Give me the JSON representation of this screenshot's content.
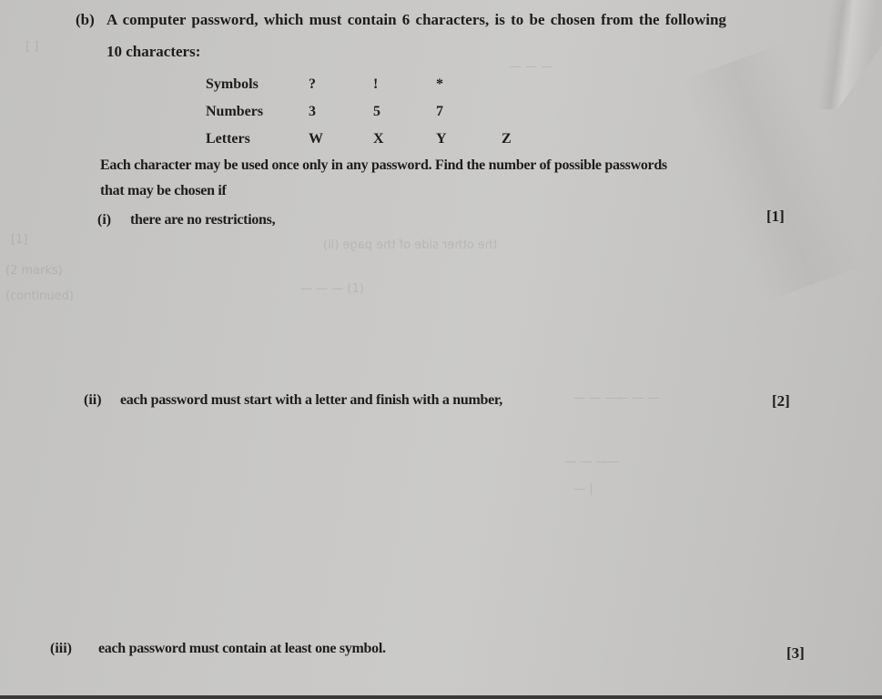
{
  "document": {
    "part_label": "(b)",
    "intro_line1": "A computer password, which must contain 6 characters, is to be chosen from the following",
    "intro_line2": "10 characters:",
    "character_table": [
      {
        "label": "Symbols",
        "values": [
          "?",
          "!",
          "*"
        ]
      },
      {
        "label": "Numbers",
        "values": [
          "3",
          "5",
          "7"
        ]
      },
      {
        "label": "Letters",
        "values": [
          "W",
          "X",
          "Y",
          "Z"
        ]
      }
    ],
    "instruction_line1": "Each character may be used once only in any password. Find the number of possible passwords",
    "instruction_line2": "that may be chosen if",
    "questions": [
      {
        "number": "(i)",
        "text": "there are no restrictions,",
        "marks": "[1]"
      },
      {
        "number": "(ii)",
        "text": "each password must start with a letter and finish with a number,",
        "marks": "[2]"
      },
      {
        "number": "(iii)",
        "text": "each password must contain at least one symbol.",
        "marks": "[3]"
      }
    ]
  }
}
